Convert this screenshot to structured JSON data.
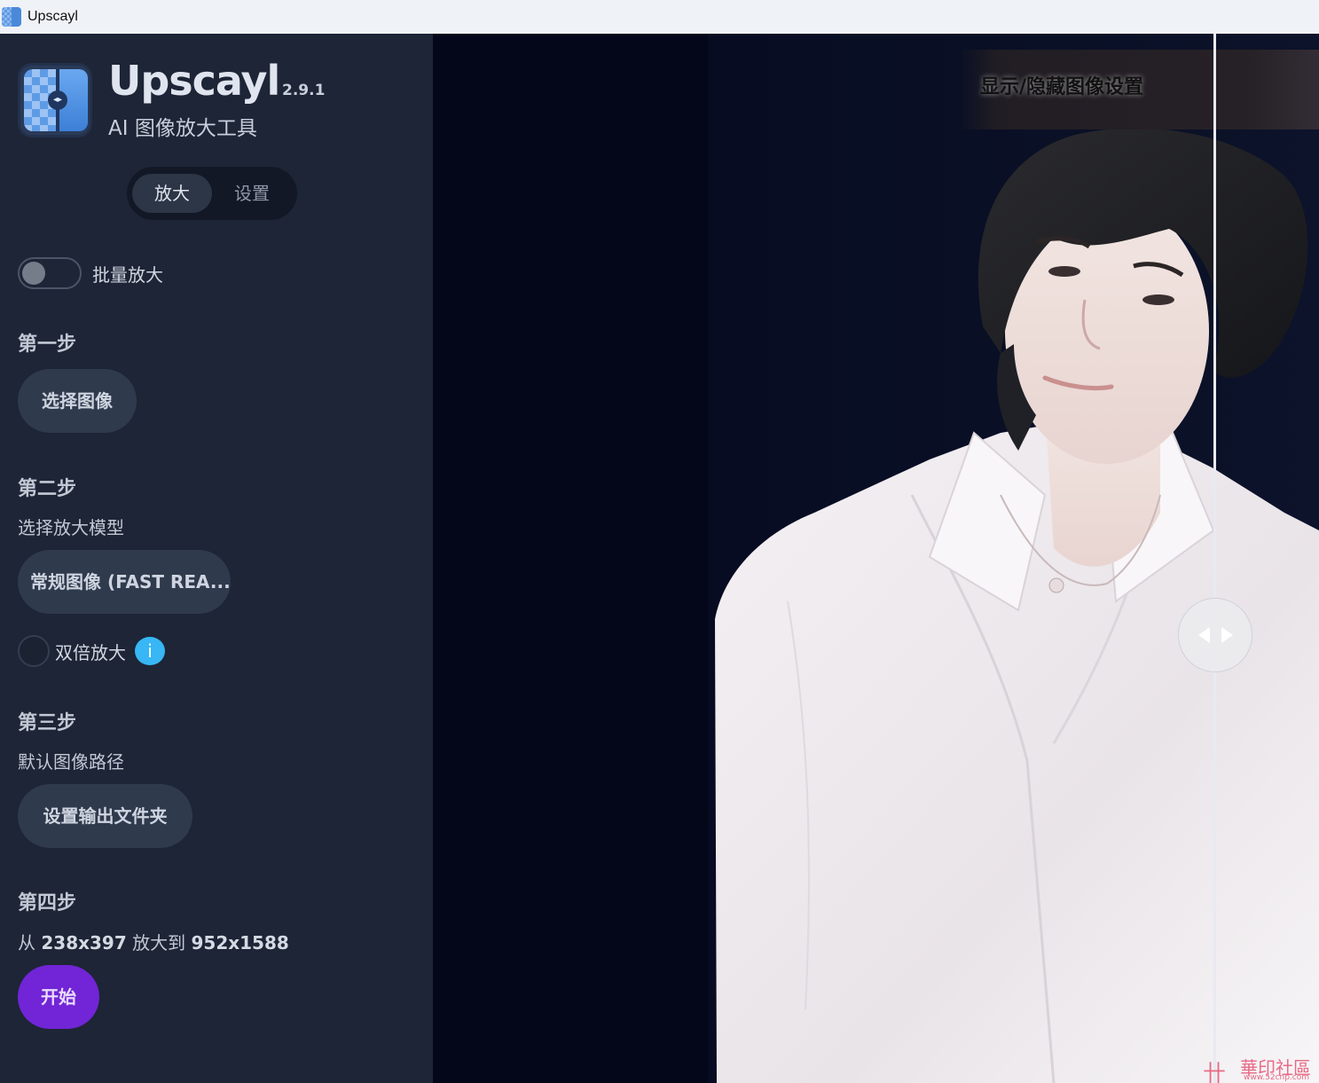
{
  "window": {
    "title": "Upscayl"
  },
  "brand": {
    "name": "Upscayl",
    "version": "2.9.1",
    "subtitle": "AI 图像放大工具"
  },
  "tabs": [
    {
      "label": "放大",
      "active": true
    },
    {
      "label": "设置",
      "active": false
    }
  ],
  "batch": {
    "label": "批量放大",
    "enabled": false
  },
  "steps": {
    "step1": {
      "heading": "第一步",
      "button": "选择图像"
    },
    "step2": {
      "heading": "第二步",
      "subtitle": "选择放大模型",
      "model": "常规图像 (FAST REA...",
      "double_label": "双倍放大",
      "double_checked": false,
      "info_icon": "i"
    },
    "step3": {
      "heading": "第三步",
      "subtitle": "默认图像路径",
      "button": "设置输出文件夹"
    },
    "step4": {
      "heading": "第四步",
      "from_word": "从",
      "from_size": "238x397",
      "to_word": "放大到",
      "to_size": "952x1588",
      "button": "开始"
    }
  },
  "viewer": {
    "settings_toggle": "显示/隐藏图像设置",
    "watermark_text": "華印社區",
    "watermark_url": "www.52cnp.com"
  },
  "colors": {
    "sidebar_bg": "#1d2536",
    "start_button": "#7125d6",
    "info_icon": "#38b6f5",
    "viewer_bg": "#05081a"
  }
}
